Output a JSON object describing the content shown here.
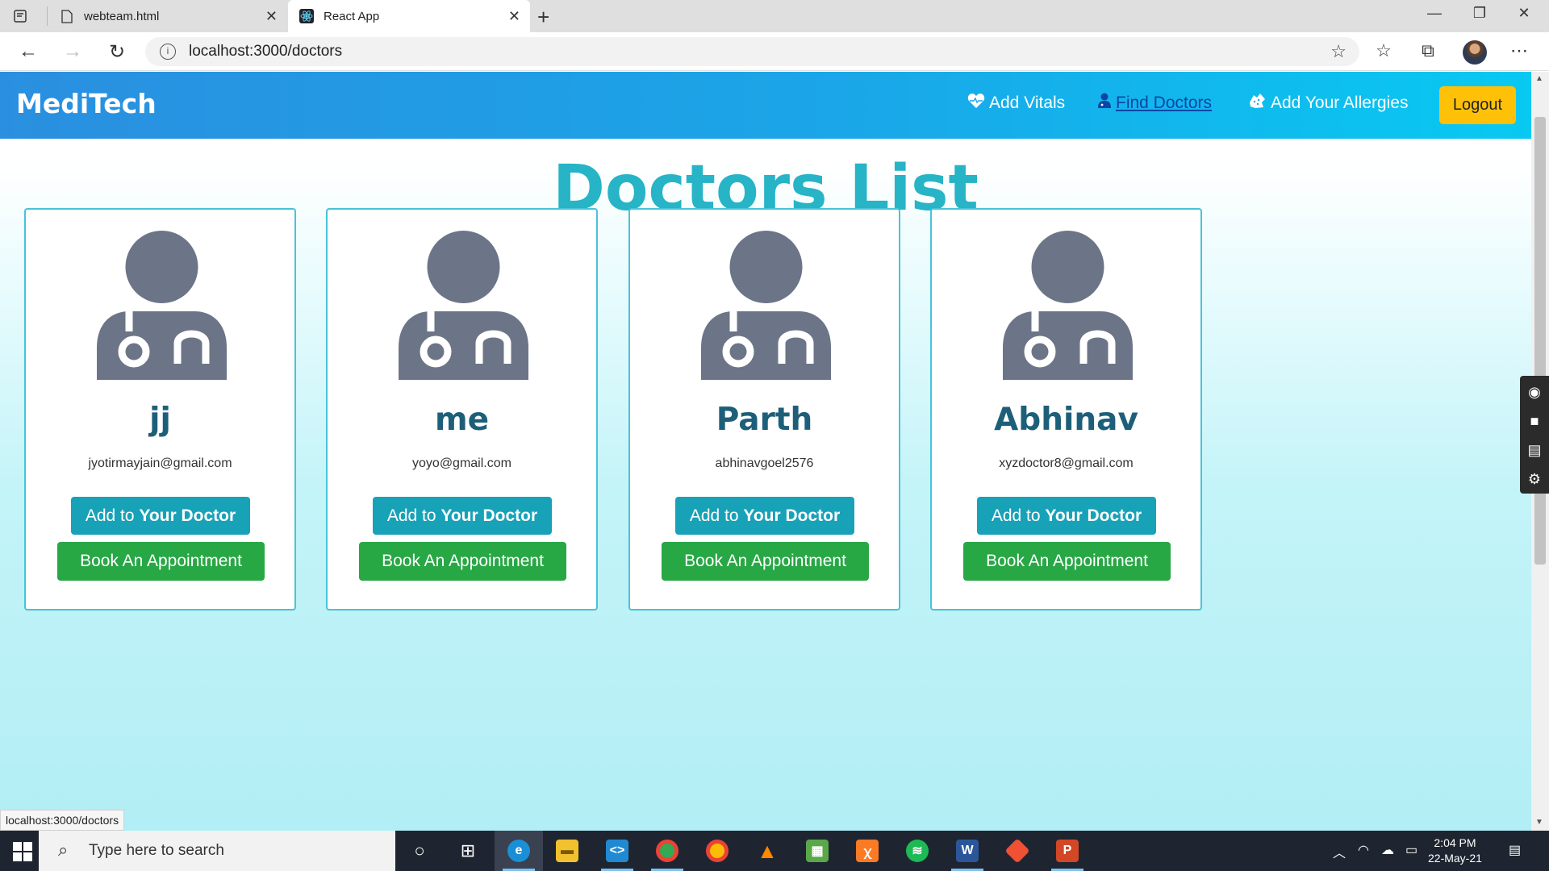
{
  "browser": {
    "tabs": [
      {
        "title": "webteam.html",
        "active": false
      },
      {
        "title": "React App",
        "active": true
      }
    ],
    "url": "localhost:3000/doctors",
    "status_url": "localhost:3000/doctors"
  },
  "navbar": {
    "brand": "MediTech",
    "links": [
      {
        "label": "Add Vitals",
        "icon": "heartbeat-icon"
      },
      {
        "label": "Find Doctors",
        "icon": "user-doctor-icon",
        "active": true
      },
      {
        "label": "Add Your Allergies",
        "icon": "allergies-icon"
      }
    ],
    "logout_label": "Logout"
  },
  "page": {
    "title": "Doctors List"
  },
  "doctors": [
    {
      "name": "jj",
      "email": "jyotirmayjain@gmail.com"
    },
    {
      "name": "me",
      "email": "yoyo@gmail.com"
    },
    {
      "name": "Parth",
      "email": "abhinavgoel2576"
    },
    {
      "name": "Abhinav",
      "email": "xyzdoctor8@gmail.com"
    }
  ],
  "card_buttons": {
    "add_prefix": "Add to ",
    "add_bold": "Your Doctor",
    "book": "Book An Appointment"
  },
  "colors": {
    "navbar_start": "#2a8fe0",
    "navbar_end": "#08c9f2",
    "title": "#26b4c6",
    "add_button": "#17a2b8",
    "book_button": "#28a745",
    "logout_button": "#ffc107",
    "doctor_name": "#1d5f79"
  },
  "taskbar": {
    "search_placeholder": "Type here to search",
    "time": "2:04 PM",
    "date": "22-May-21"
  }
}
